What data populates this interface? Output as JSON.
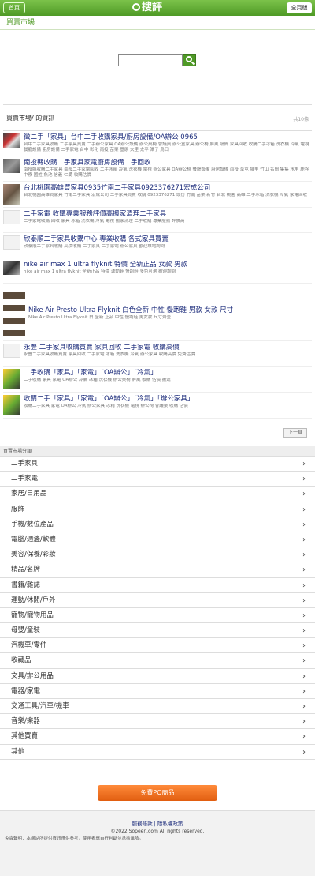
{
  "topbar": {
    "back_label": "首頁",
    "logo_text": "搜評",
    "full_label": "全頁版"
  },
  "category": {
    "title": "買賣市場"
  },
  "search": {
    "placeholder": ""
  },
  "results": {
    "title": "買賣市場/ 的資訊",
    "count": "共10條"
  },
  "items": [
    {
      "title": "徵二手「家具」台中二手收購家具/廚房設備/OA辦公 0965",
      "desc": "台中二手家具收購 二手家具買賣 二手辦公家具 OA辦公設備 辦公桌椅 會議桌 辦公室家具 辦公椅 屏風 隔間 家具回收 收購二手冰箱 洗衣機 冷氣 電視 餐廳設備 廚房設備 二手家電 台中 彰化 南投 苗栗 豐原 大里 太平 潭子 烏日"
    },
    {
      "title": "南投縣收購二手家具家電廚房設備二手回收",
      "desc": "南投縣收購二手家具 南投二手家電回收 二手冰箱 冷氣 洗衣機 電視 辦公家具 OA辦公椅 餐廳設備 廚房設備 南投 草屯 埔里 竹山 名間 集集 水里 鹿谷 中寮 國姓 魚池 信義 仁愛 收購估價"
    },
    {
      "title": "台北桃園高雄買家具0935竹南二手家具0923376271宏成公司",
      "desc": "台北桃園高雄買家具 竹南二手家具 宏成公司 二手家具買賣 收購 0923376271 頭份 竹南 苗栗 新竹 台北 桃園 高雄 二手冰箱 洗衣機 冷氣 家電回收"
    },
    {
      "title": "二手家電 收購專業服務評價高搬家清理二手家具",
      "desc": "二手家電收購 回收 家具 冰箱 洗衣機 冷氣 電視 搬家清理 二手收購 專業服務 評價高"
    },
    {
      "title": "欣泰順二手家具收購中心 專業收購 各式家具買賣",
      "desc": "欣泰順二手家具收購 高價收購 二手家具 二手家電 辦公家具 歡迎來電詢問"
    },
    {
      "title": "nike air max 1 ultra flyknit 特價 全新正品 女款 男款",
      "desc": "nike air max 1 ultra flyknit 全新正品 特價 運動鞋 慢跑鞋 多色可選 歡迎詢問"
    },
    {
      "title": "Nike Air Presto Ultra Flyknit 白色全新 中性 慢跑鞋 男款 女款 尺寸",
      "desc": "Nike Air Presto Ultra Flyknit 白 全新 正品 中性 慢跑鞋 男女款 尺寸齊全"
    },
    {
      "title": "永豐 二手家具收購買賣 家具回收 二手家電 收購高價",
      "desc": "永豐二手家具收購買賣 家具回收 二手家電 冰箱 洗衣機 冷氣 辦公家具 收購高價 免費估價"
    },
    {
      "title": "二手收購「家具」「家電」「OA辦公」「冷氣」",
      "desc": "二手收購 家具 家電 OA辦公 冷氣 冰箱 洗衣機 辦公桌椅 屏風 收購 估價 搬運"
    },
    {
      "title": "收購二手「家具」「家電」「OA辦公」「冷氣」「辦公家具」",
      "desc": "收購二手家具 家電 OA辦公 冷氣 辦公家具 冰箱 洗衣機 電視 辦公椅 會議桌 收購 估價"
    }
  ],
  "pager": {
    "next_label": "下一頁"
  },
  "categories_title": "買賣市場分類",
  "categories": [
    "二手家具",
    "二手家電",
    "家居/日用品",
    "服飾",
    "手機/數位產品",
    "電腦/週邊/軟體",
    "美容/保養/彩妝",
    "精品/名牌",
    "書籍/雜誌",
    "運動/休閒/戶外",
    "寵物/寵物用品",
    "母嬰/童裝",
    "汽機車/零件",
    "收藏品",
    "文具/辦公用品",
    "電器/家電",
    "交通工具/汽車/機車",
    "音樂/樂器",
    "其他買賣",
    "其他"
  ],
  "cta": {
    "label": "免費PO商品"
  },
  "footer": {
    "links": "服務條款 | 隱私權政策",
    "copyright": "©2022 Sopeen.com All rights reserved.",
    "disclaimer": "免責聲明：本網站所提供資訊僅供參考，使用者應自行判斷並承擔風險。"
  },
  "colors": {
    "brand": "#4f9a26",
    "cta": "#e15e10",
    "link": "#1a2a7a"
  }
}
